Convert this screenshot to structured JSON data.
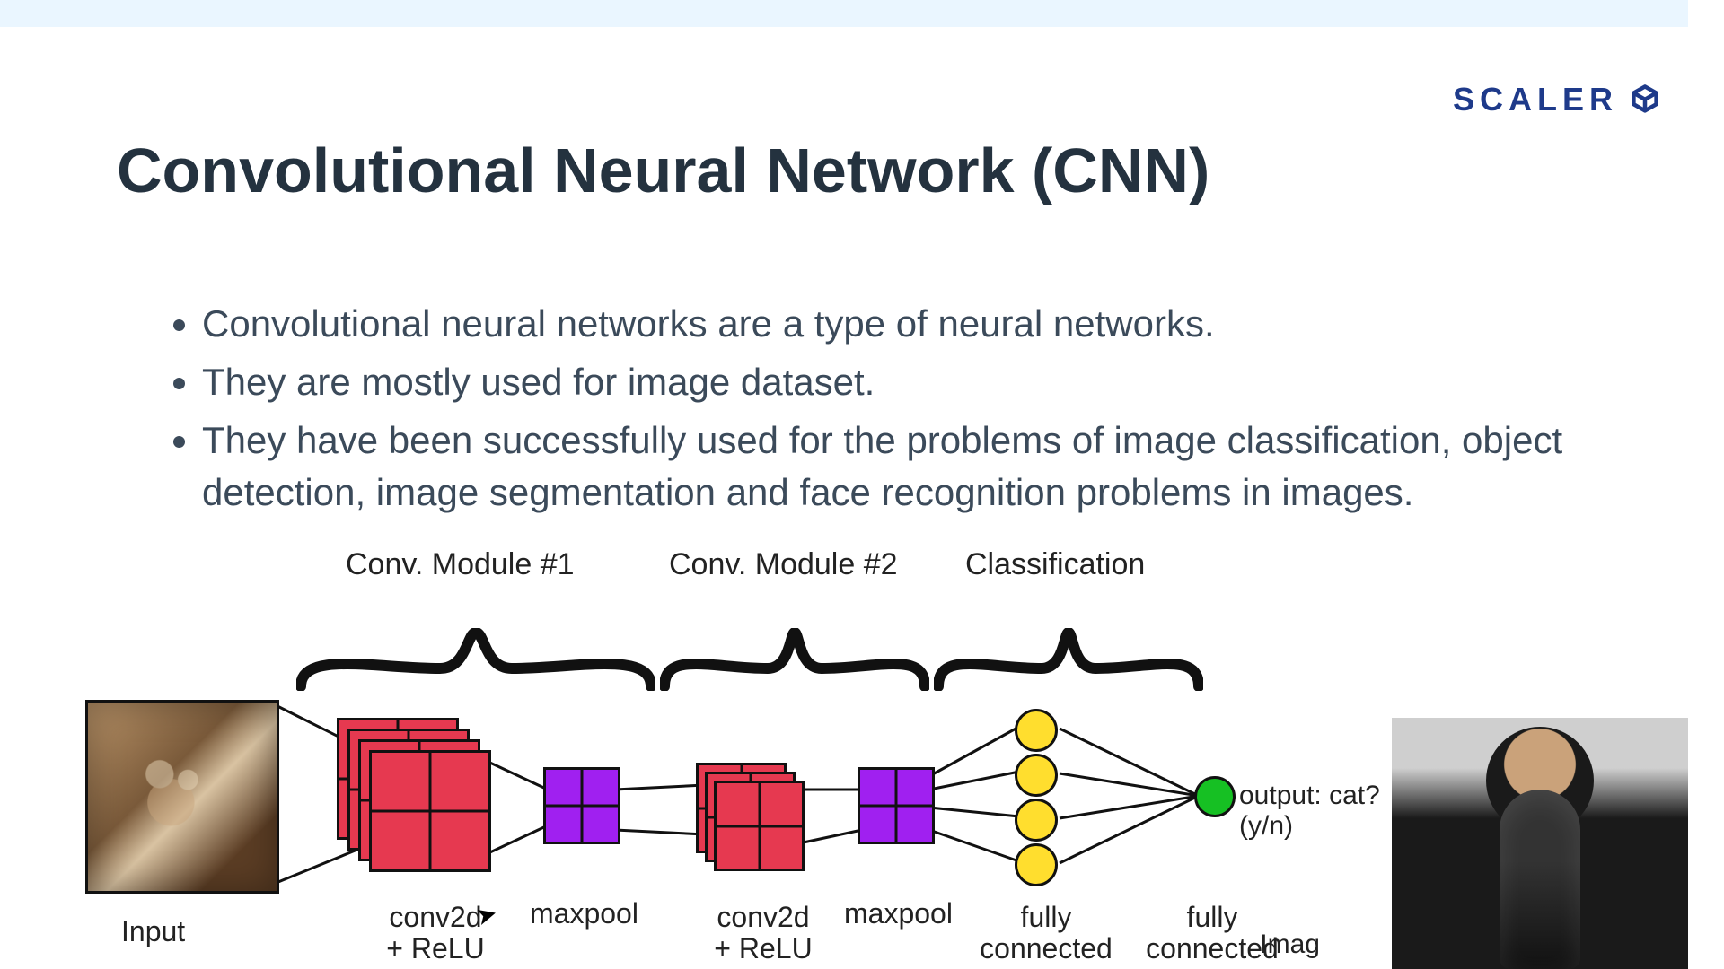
{
  "brand": "SCALER",
  "title": "Convolutional Neural Network (CNN)",
  "bullets": [
    "Convolutional neural networks are a type of neural networks.",
    "They are mostly used for image dataset.",
    "They have been successfully used for the problems of image classification, object detection, image segmentation and face recognition problems in images."
  ],
  "diagram": {
    "moduleLabels": {
      "m1": "Conv. Module #1",
      "m2": "Conv. Module #2",
      "cls": "Classification"
    },
    "inputLabel": "Input",
    "layers": {
      "conv1": "conv2d\n+ ReLU",
      "pool1": "maxpool",
      "conv2": "conv2d\n+ ReLU",
      "pool2": "maxpool",
      "fc1": "fully\nconnected",
      "fc2": "fully\nconnected"
    },
    "outputText": "output: cat? (y/n)"
  },
  "colors": {
    "conv": "#e63950",
    "pool": "#a020f0",
    "hidden": "#ffde2e",
    "output": "#16c023",
    "brand": "#1e3a8a"
  },
  "creditPartial": "Imag"
}
